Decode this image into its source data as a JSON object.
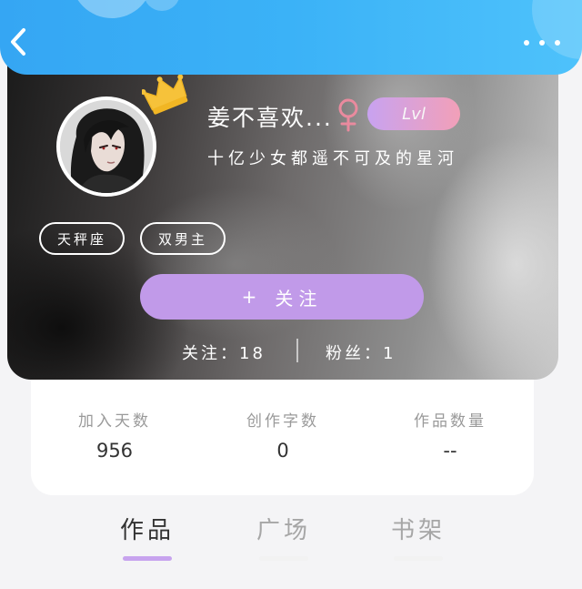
{
  "profile": {
    "username": "姜不喜欢...",
    "level": "Lvl",
    "signature": "十亿少女都遥不可及的星河",
    "tags": [
      "天秤座",
      "双男主"
    ],
    "follow_button": {
      "plus": "+",
      "label": "关注"
    },
    "follow_count_label": "关注：",
    "follow_count": "18",
    "fans_label": "粉丝：",
    "fans_count": "1"
  },
  "stats": [
    {
      "label": "加入天数",
      "value": "956"
    },
    {
      "label": "创作字数",
      "value": "0"
    },
    {
      "label": "作品数量",
      "value": "--"
    }
  ],
  "tabs": [
    {
      "label": "作品",
      "active": true
    },
    {
      "label": "广场",
      "active": false
    },
    {
      "label": "书架",
      "active": false
    }
  ],
  "colors": {
    "header_blue": "#3bb2f7",
    "accent_purple": "#c19ae9",
    "gender_pink": "#e98a9e",
    "crown_yellow": "#f6c23a"
  },
  "icons": {
    "back": "chevron-left-icon",
    "more": "more-dots-icon",
    "crown": "crown-icon",
    "gender": "female-symbol-icon"
  }
}
